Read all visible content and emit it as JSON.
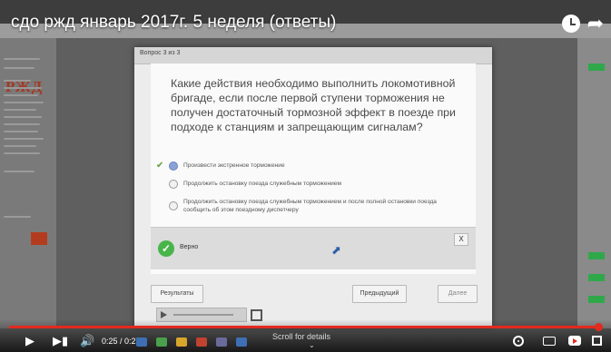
{
  "video": {
    "title": "сдо ржд январь 2017г. 5 неделя (ответы)"
  },
  "background_page": {
    "logo": "РЖД"
  },
  "dialog": {
    "question_counter": "Вопрос 3 из 3",
    "question": "Какие действия необходимо выполнить локомотивной бригаде, если после первой ступени торможения не получен достаточный тормозной эффект в поезде при подходе к станциям и запрещающим сигналам?",
    "answers": [
      {
        "text": "Произвести экстренное торможение",
        "selected": true,
        "correct": true
      },
      {
        "text": "Продолжить остановку поезда служебным торможением",
        "selected": false,
        "correct": false
      },
      {
        "text": "Продолжить остановку поезда служебным торможением и после полной остановки поезда сообщить об этом поездному диспетчеру",
        "selected": false,
        "correct": false
      }
    ],
    "feedback": "Верно",
    "close_label": "X",
    "results_button": "Результаты",
    "prev_button": "Предыдущий",
    "next_button": "Далее"
  },
  "player": {
    "time": "0:25 / 0:25",
    "scroll_hint": "Scroll for details",
    "progress": 1.0,
    "accent_color": "#e22a1e"
  },
  "colors": {
    "correct_green": "#48b54a",
    "check_green": "#5a9f3b"
  }
}
